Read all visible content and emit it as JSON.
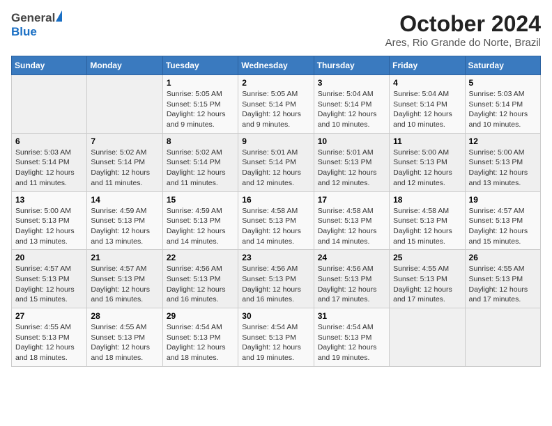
{
  "header": {
    "logo_general": "General",
    "logo_blue": "Blue",
    "title": "October 2024",
    "subtitle": "Ares, Rio Grande do Norte, Brazil"
  },
  "weekdays": [
    "Sunday",
    "Monday",
    "Tuesday",
    "Wednesday",
    "Thursday",
    "Friday",
    "Saturday"
  ],
  "weeks": [
    [
      {
        "day": "",
        "info": ""
      },
      {
        "day": "",
        "info": ""
      },
      {
        "day": "1",
        "info": "Sunrise: 5:05 AM\nSunset: 5:15 PM\nDaylight: 12 hours and 9 minutes."
      },
      {
        "day": "2",
        "info": "Sunrise: 5:05 AM\nSunset: 5:14 PM\nDaylight: 12 hours and 9 minutes."
      },
      {
        "day": "3",
        "info": "Sunrise: 5:04 AM\nSunset: 5:14 PM\nDaylight: 12 hours and 10 minutes."
      },
      {
        "day": "4",
        "info": "Sunrise: 5:04 AM\nSunset: 5:14 PM\nDaylight: 12 hours and 10 minutes."
      },
      {
        "day": "5",
        "info": "Sunrise: 5:03 AM\nSunset: 5:14 PM\nDaylight: 12 hours and 10 minutes."
      }
    ],
    [
      {
        "day": "6",
        "info": "Sunrise: 5:03 AM\nSunset: 5:14 PM\nDaylight: 12 hours and 11 minutes."
      },
      {
        "day": "7",
        "info": "Sunrise: 5:02 AM\nSunset: 5:14 PM\nDaylight: 12 hours and 11 minutes."
      },
      {
        "day": "8",
        "info": "Sunrise: 5:02 AM\nSunset: 5:14 PM\nDaylight: 12 hours and 11 minutes."
      },
      {
        "day": "9",
        "info": "Sunrise: 5:01 AM\nSunset: 5:14 PM\nDaylight: 12 hours and 12 minutes."
      },
      {
        "day": "10",
        "info": "Sunrise: 5:01 AM\nSunset: 5:13 PM\nDaylight: 12 hours and 12 minutes."
      },
      {
        "day": "11",
        "info": "Sunrise: 5:00 AM\nSunset: 5:13 PM\nDaylight: 12 hours and 12 minutes."
      },
      {
        "day": "12",
        "info": "Sunrise: 5:00 AM\nSunset: 5:13 PM\nDaylight: 12 hours and 13 minutes."
      }
    ],
    [
      {
        "day": "13",
        "info": "Sunrise: 5:00 AM\nSunset: 5:13 PM\nDaylight: 12 hours and 13 minutes."
      },
      {
        "day": "14",
        "info": "Sunrise: 4:59 AM\nSunset: 5:13 PM\nDaylight: 12 hours and 13 minutes."
      },
      {
        "day": "15",
        "info": "Sunrise: 4:59 AM\nSunset: 5:13 PM\nDaylight: 12 hours and 14 minutes."
      },
      {
        "day": "16",
        "info": "Sunrise: 4:58 AM\nSunset: 5:13 PM\nDaylight: 12 hours and 14 minutes."
      },
      {
        "day": "17",
        "info": "Sunrise: 4:58 AM\nSunset: 5:13 PM\nDaylight: 12 hours and 14 minutes."
      },
      {
        "day": "18",
        "info": "Sunrise: 4:58 AM\nSunset: 5:13 PM\nDaylight: 12 hours and 15 minutes."
      },
      {
        "day": "19",
        "info": "Sunrise: 4:57 AM\nSunset: 5:13 PM\nDaylight: 12 hours and 15 minutes."
      }
    ],
    [
      {
        "day": "20",
        "info": "Sunrise: 4:57 AM\nSunset: 5:13 PM\nDaylight: 12 hours and 15 minutes."
      },
      {
        "day": "21",
        "info": "Sunrise: 4:57 AM\nSunset: 5:13 PM\nDaylight: 12 hours and 16 minutes."
      },
      {
        "day": "22",
        "info": "Sunrise: 4:56 AM\nSunset: 5:13 PM\nDaylight: 12 hours and 16 minutes."
      },
      {
        "day": "23",
        "info": "Sunrise: 4:56 AM\nSunset: 5:13 PM\nDaylight: 12 hours and 16 minutes."
      },
      {
        "day": "24",
        "info": "Sunrise: 4:56 AM\nSunset: 5:13 PM\nDaylight: 12 hours and 17 minutes."
      },
      {
        "day": "25",
        "info": "Sunrise: 4:55 AM\nSunset: 5:13 PM\nDaylight: 12 hours and 17 minutes."
      },
      {
        "day": "26",
        "info": "Sunrise: 4:55 AM\nSunset: 5:13 PM\nDaylight: 12 hours and 17 minutes."
      }
    ],
    [
      {
        "day": "27",
        "info": "Sunrise: 4:55 AM\nSunset: 5:13 PM\nDaylight: 12 hours and 18 minutes."
      },
      {
        "day": "28",
        "info": "Sunrise: 4:55 AM\nSunset: 5:13 PM\nDaylight: 12 hours and 18 minutes."
      },
      {
        "day": "29",
        "info": "Sunrise: 4:54 AM\nSunset: 5:13 PM\nDaylight: 12 hours and 18 minutes."
      },
      {
        "day": "30",
        "info": "Sunrise: 4:54 AM\nSunset: 5:13 PM\nDaylight: 12 hours and 19 minutes."
      },
      {
        "day": "31",
        "info": "Sunrise: 4:54 AM\nSunset: 5:13 PM\nDaylight: 12 hours and 19 minutes."
      },
      {
        "day": "",
        "info": ""
      },
      {
        "day": "",
        "info": ""
      }
    ]
  ]
}
